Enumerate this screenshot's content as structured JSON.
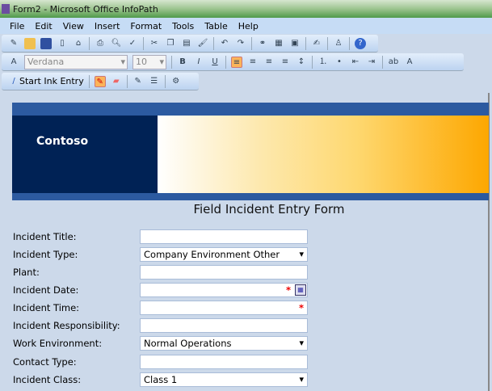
{
  "window": {
    "title": "Form2 - Microsoft Office InfoPath"
  },
  "menu": [
    "File",
    "Edit",
    "View",
    "Insert",
    "Format",
    "Tools",
    "Table",
    "Help"
  ],
  "toolbar": {
    "font": "Verdana",
    "size": "10",
    "ink_label": "Start Ink Entry"
  },
  "banner": {
    "company": "Contoso"
  },
  "form": {
    "title": "Field Incident Entry Form",
    "fields": [
      {
        "label": "Incident Title:",
        "value": ""
      },
      {
        "label": "Incident Type:",
        "value": "Company Environment Other"
      },
      {
        "label": "Plant:",
        "value": ""
      },
      {
        "label": "Incident Date:",
        "value": ""
      },
      {
        "label": "Incident Time:",
        "value": ""
      },
      {
        "label": "Incident Responsibility:",
        "value": ""
      },
      {
        "label": "Work Environment:",
        "value": "Normal Operations"
      },
      {
        "label": "Contact Type:",
        "value": ""
      },
      {
        "label": "Incident Class:",
        "value": "Class 1"
      }
    ],
    "required_mark": "*"
  }
}
